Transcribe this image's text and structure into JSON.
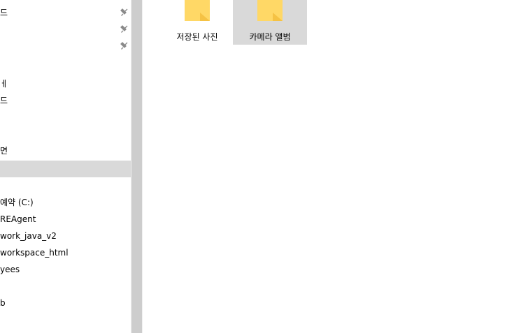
{
  "nav": {
    "items": [
      {
        "label": "드",
        "pinned": true
      },
      {
        "label": "",
        "pinned": true
      },
      {
        "label": "",
        "pinned": true
      },
      {
        "label": "ㅔ"
      },
      {
        "label": "드"
      },
      {
        "label": "면"
      },
      {
        "label": "",
        "selected": true
      },
      {
        "label": "예약 (C:)"
      },
      {
        "label": "REAgent"
      },
      {
        "label": "work_java_v2"
      },
      {
        "label": "workspace_html"
      },
      {
        "label": "yees"
      },
      {
        "label": "b"
      }
    ]
  },
  "content": {
    "folders": [
      {
        "label": "저장된 사진",
        "icon": "folder-icon"
      },
      {
        "label": "카메라 앨범",
        "icon": "folder-icon",
        "selected": true
      }
    ]
  },
  "colors": {
    "selection": "#d9d9d9",
    "folder_body": "#ffd866",
    "folder_back": "#e8b94a",
    "pin": "#8a8a8a",
    "scroll_thumb": "#cdcdcd"
  }
}
